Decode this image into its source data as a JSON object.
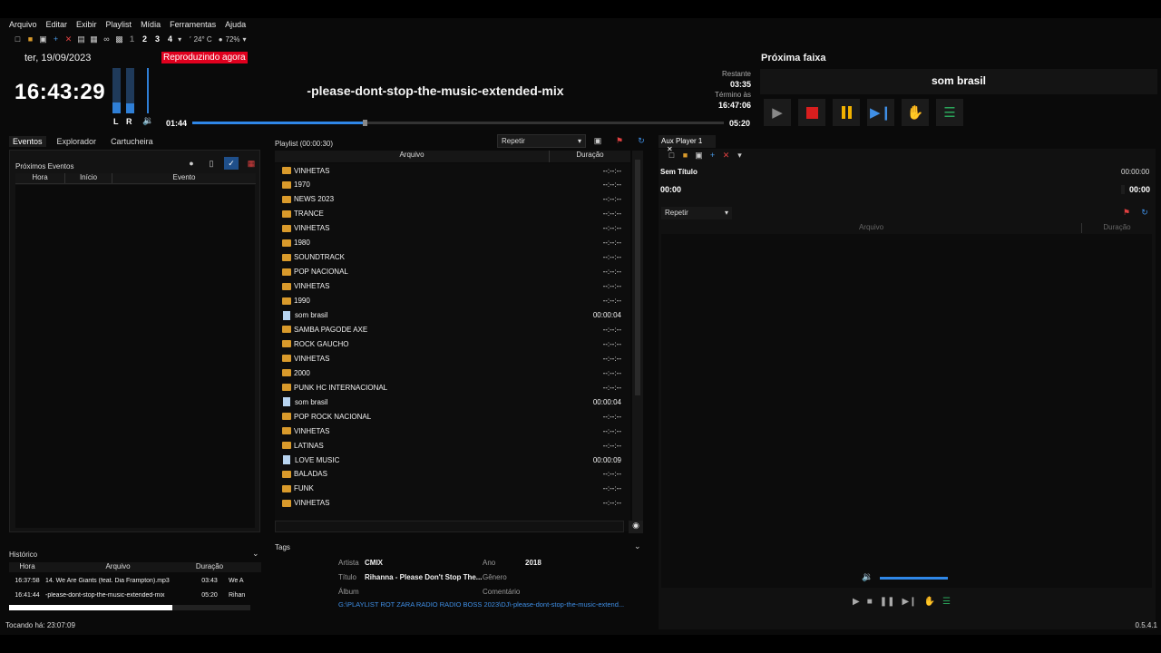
{
  "menu": [
    "Arquivo",
    "Editar",
    "Exibir",
    "Playlist",
    "Mídia",
    "Ferramentas",
    "Ajuda"
  ],
  "toolbar": {
    "numbers": [
      "1",
      "2",
      "3",
      "4"
    ],
    "temperature": "24° C",
    "humidity": "72%"
  },
  "header": {
    "date": "ter, 19/09/2023",
    "clock": "16:43:29",
    "now_playing_label": "Reproduzindo agora",
    "title": "-please-dont-stop-the-music-extended-mix",
    "remaining_label": "Restante",
    "remaining": "03:35",
    "ends_label": "Término às",
    "ends_at": "16:47:06",
    "elapsed": "01:44",
    "total": "05:20",
    "progress": 0.325,
    "vu_left": 0.25,
    "vu_right": 0.22,
    "channel_left": "L",
    "channel_right": "R"
  },
  "next": {
    "label": "Próxima faixa",
    "title": "som brasil"
  },
  "left_tabs": [
    "Eventos",
    "Explorador",
    "Cartucheira"
  ],
  "events": {
    "title": "Próximos Eventos",
    "columns": [
      "Hora",
      "Início",
      "Evento"
    ]
  },
  "history": {
    "label": "Histórico",
    "columns": [
      "Hora",
      "Arquivo",
      "Duração"
    ],
    "rows": [
      {
        "time": "16:37:58",
        "file": "14. We Are Giants (feat. Dia Frampton).mp3",
        "duration": "03:43",
        "extra": "We A"
      },
      {
        "time": "16:41:44",
        "file": "-please-dont-stop-the-music-extended-mix",
        "duration": "05:20",
        "extra": "Rihan"
      }
    ]
  },
  "playlist": {
    "title": "Playlist (00:00:30)",
    "repeat": "Repetir",
    "columns": [
      "Arquivo",
      "Duração"
    ],
    "rows": [
      {
        "name": "VINHETAS",
        "type": "folder",
        "dur": "--:--:--"
      },
      {
        "name": "1970",
        "type": "folder",
        "dur": "--:--:--"
      },
      {
        "name": "NEWS 2023",
        "type": "folder",
        "dur": "--:--:--"
      },
      {
        "name": "TRANCE",
        "type": "folder",
        "dur": "--:--:--"
      },
      {
        "name": "VINHETAS",
        "type": "folder",
        "dur": "--:--:--"
      },
      {
        "name": "1980",
        "type": "folder",
        "dur": "--:--:--"
      },
      {
        "name": "SOUNDTRACK",
        "type": "folder",
        "dur": "--:--:--"
      },
      {
        "name": "POP NACIONAL",
        "type": "folder",
        "dur": "--:--:--"
      },
      {
        "name": "VINHETAS",
        "type": "folder",
        "dur": "--:--:--"
      },
      {
        "name": "1990",
        "type": "folder",
        "dur": "--:--:--"
      },
      {
        "name": "som brasil",
        "type": "file",
        "dur": "00:00:04"
      },
      {
        "name": "SAMBA PAGODE AXE",
        "type": "folder",
        "dur": "--:--:--"
      },
      {
        "name": "ROCK GAUCHO",
        "type": "folder",
        "dur": "--:--:--"
      },
      {
        "name": "VINHETAS",
        "type": "folder",
        "dur": "--:--:--"
      },
      {
        "name": "2000",
        "type": "folder",
        "dur": "--:--:--"
      },
      {
        "name": "PUNK HC INTERNACIONAL",
        "type": "folder",
        "dur": "--:--:--"
      },
      {
        "name": "som brasil",
        "type": "file",
        "dur": "00:00:04"
      },
      {
        "name": "POP ROCK NACIONAL",
        "type": "folder",
        "dur": "--:--:--"
      },
      {
        "name": "VINHETAS",
        "type": "folder",
        "dur": "--:--:--"
      },
      {
        "name": "LATINAS",
        "type": "folder",
        "dur": "--:--:--"
      },
      {
        "name": "LOVE MUSIC",
        "type": "file",
        "dur": "00:00:09"
      },
      {
        "name": "BALADAS",
        "type": "folder",
        "dur": "--:--:--"
      },
      {
        "name": "FUNK",
        "type": "folder",
        "dur": "--:--:--"
      },
      {
        "name": "VINHETAS",
        "type": "folder",
        "dur": "--:--:--"
      }
    ]
  },
  "tags": {
    "label": "Tags",
    "artist_label": "Artista",
    "artist": "CMIX",
    "year_label": "Ano",
    "year": "2018",
    "title_label": "Título",
    "title": "Rihanna - Please Don't Stop The...",
    "genre_label": "Gênero",
    "album_label": "Álbum",
    "comment_label": "Comentário",
    "path": "G:\\PLAYLIST ROT ZARA RADIO RADIO BOSS 2023\\DJ\\-please-dont-stop-the-music-extend..."
  },
  "aux": {
    "tab": "Aux Player 1",
    "title": "Sem Título",
    "duration": "00:00:00",
    "position": "00:00",
    "position_right": "00:00",
    "repeat": "Repetir",
    "columns": [
      "Arquivo",
      "Duração"
    ],
    "volume": 1.0
  },
  "status": {
    "left": "Tocando há: 23:07:09",
    "version": "0.5.4.1"
  },
  "colors": {
    "accent_blue": "#2f87e8",
    "now_playing_red": "#e0001e",
    "stop_red": "#d81e1e",
    "pause_yellow": "#f2b200",
    "folder": "#d99a2b"
  }
}
